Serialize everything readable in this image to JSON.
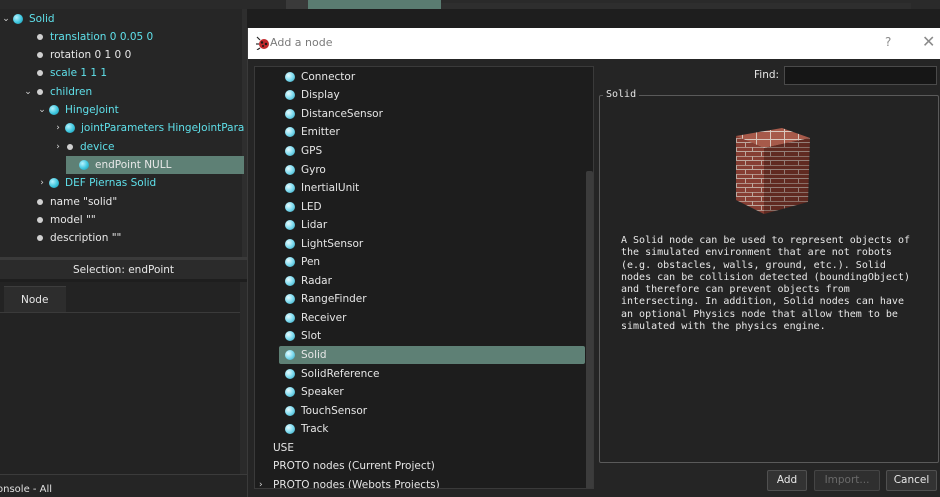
{
  "scene_tree": {
    "rows": [
      {
        "label": "Solid",
        "kind": "ball",
        "arrow": "⌄",
        "color": "cyan"
      },
      {
        "label": "translation 0 0.05 0",
        "kind": "dot",
        "color": "cyan"
      },
      {
        "label": "rotation 0 1 0 0",
        "kind": "dot",
        "color": "white"
      },
      {
        "label": "scale 1 1 1",
        "kind": "dot",
        "color": "cyan"
      },
      {
        "label": "children",
        "kind": "dot",
        "arrow": "⌄",
        "color": "cyan"
      },
      {
        "label": "HingeJoint",
        "kind": "ball",
        "arrow": "⌄",
        "color": "cyan"
      },
      {
        "label": "jointParameters HingeJointPara",
        "kind": "ball",
        "arrow": "›",
        "color": "cyan"
      },
      {
        "label": "device",
        "kind": "dot",
        "arrow": "›",
        "color": "cyan"
      },
      {
        "label": "endPoint NULL",
        "kind": "ball",
        "color": "white",
        "selected": true
      },
      {
        "label": "DEF Piernas Solid",
        "kind": "ball",
        "arrow": "›",
        "color": "cyan"
      },
      {
        "label": "name \"solid\"",
        "kind": "dot",
        "color": "white"
      },
      {
        "label": "model \"\"",
        "kind": "dot",
        "color": "white"
      },
      {
        "label": "description \"\"",
        "kind": "dot",
        "color": "white"
      }
    ]
  },
  "selection_label": "Selection: endPoint",
  "node_tab": "Node",
  "console_label": "onsole - All",
  "dialog": {
    "title": "Add a node",
    "help": "?",
    "close": "✕",
    "find_label": "Find:",
    "find_value": "",
    "nodes": [
      "Connector",
      "Display",
      "DistanceSensor",
      "Emitter",
      "GPS",
      "Gyro",
      "InertialUnit",
      "LED",
      "Lidar",
      "LightSensor",
      "Pen",
      "Radar",
      "RangeFinder",
      "Receiver",
      "Slot",
      "Solid",
      "SolidReference",
      "Speaker",
      "TouchSensor",
      "Track"
    ],
    "selected_node": "Solid",
    "groups": [
      {
        "label": "USE",
        "arrow": ""
      },
      {
        "label": "PROTO nodes (Current Project)",
        "arrow": ""
      },
      {
        "label": "PROTO nodes (Webots Projects)",
        "arrow": "›"
      }
    ],
    "info_title": "Solid",
    "info_text": "A Solid node can be used to represent objects of\nthe simulated environment that are not robots\n(e.g. obstacles, walls, ground, etc.). Solid\nnodes can be collision detected (boundingObject)\nand therefore can prevent objects from\nintersecting. In addition, Solid nodes can have\nan optional Physics node that allow them to be\nsimulated with the physics engine.",
    "buttons": {
      "add": "Add",
      "import": "Import...",
      "cancel": "Cancel"
    }
  },
  "colors": {
    "selection": "#5e8075",
    "cyan_text": "#5fe0ea"
  }
}
